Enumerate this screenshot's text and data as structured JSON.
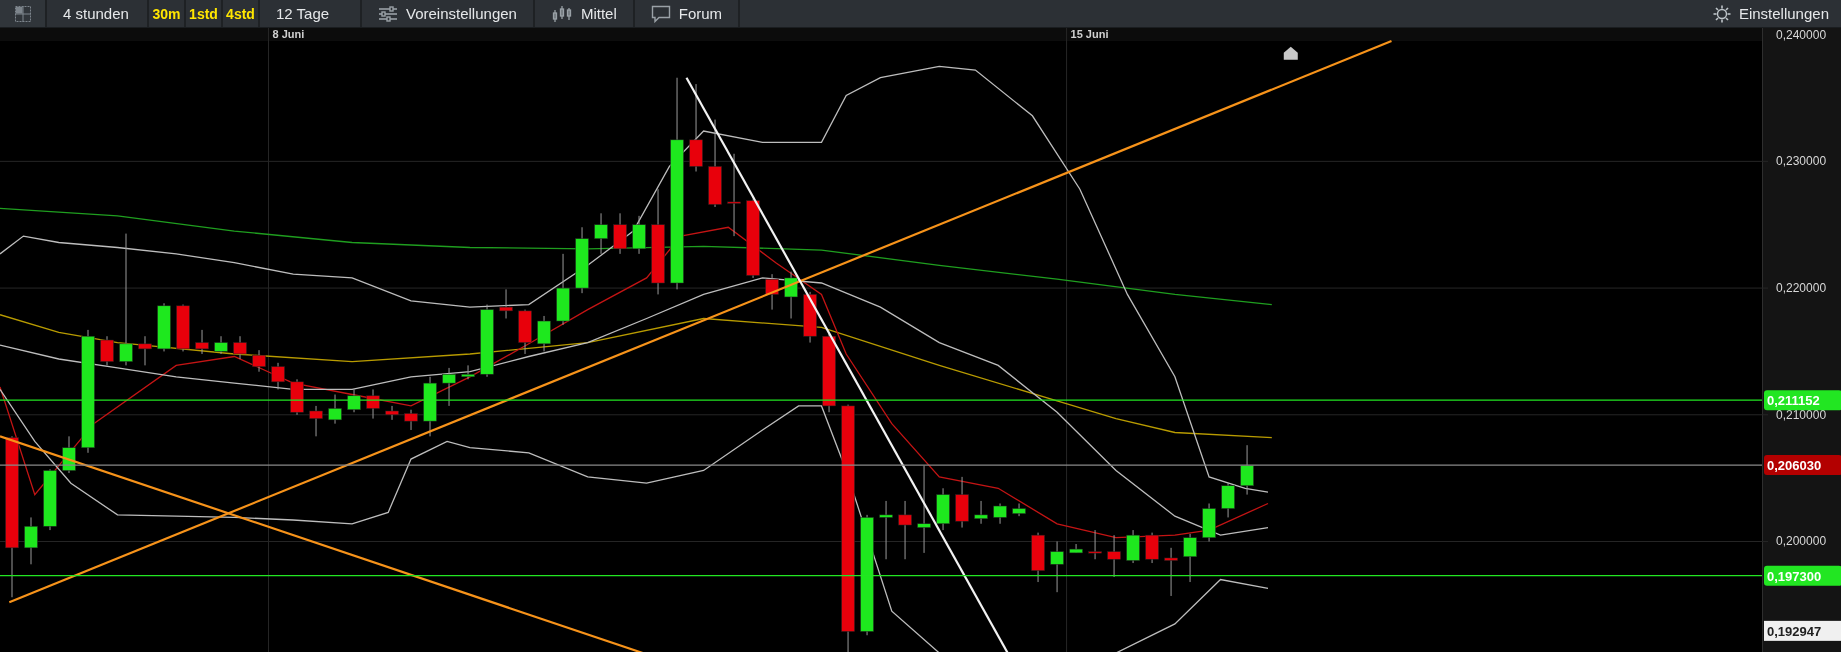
{
  "toolbar": {
    "left": [
      {
        "kind": "dropdown",
        "label": "4 stunden"
      },
      {
        "kind": "interval",
        "label": "30m"
      },
      {
        "kind": "interval",
        "label": "1std"
      },
      {
        "kind": "interval",
        "label": "4std"
      },
      {
        "kind": "dropdown",
        "label": "12 Tage"
      },
      {
        "kind": "presets",
        "label": "Voreinstellungen"
      },
      {
        "kind": "indicators",
        "label": "Mittel"
      },
      {
        "kind": "forum",
        "label": "Forum"
      }
    ],
    "right": {
      "kind": "settings",
      "label": "Einstellungen"
    }
  },
  "chart": {
    "date_labels": [
      "8 Juni",
      "15 Juni"
    ],
    "price_labels": [
      "0,240000",
      "0,230000",
      "0,220000",
      "0,210000",
      "0,200000"
    ],
    "price_tags": [
      {
        "label": "0,211152",
        "color": "#22e622"
      },
      {
        "label": "0,206030",
        "color": "#b30000"
      },
      {
        "label": "0,197300",
        "color": "#22e622"
      },
      {
        "label": "0,192947",
        "color": "#f0f0f0"
      }
    ]
  }
}
